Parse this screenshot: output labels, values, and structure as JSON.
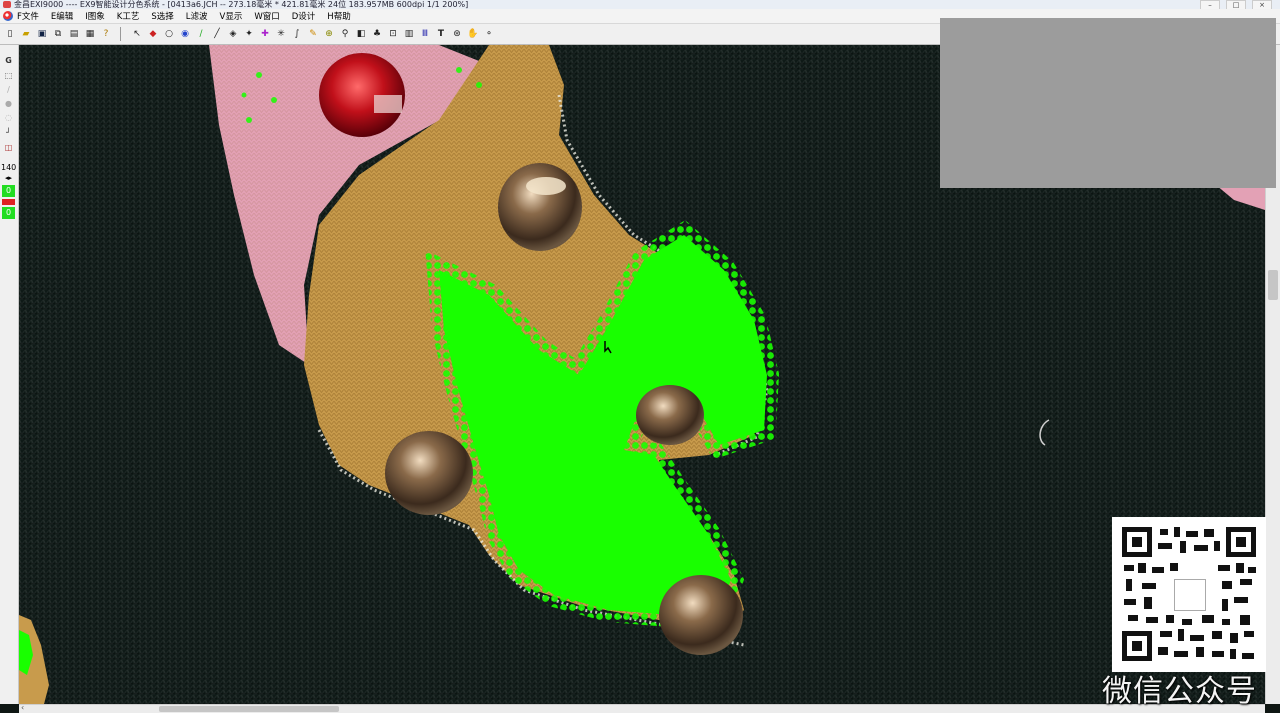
{
  "window": {
    "title": "金昌EXI9000 ---- EX9智能设计分色系统 - [0413a6.JCH -- 273.18毫米 * 421.81毫米 24位 183.957MB 600dpi 1/1 200%]"
  },
  "menubar": {
    "items": [
      "F文件",
      "E编辑",
      "I图象",
      "K工艺",
      "S选择",
      "L滤波",
      "V显示",
      "W窗口",
      "D设计",
      "H帮助"
    ]
  },
  "toolbar": {
    "icons": [
      "new-file-icon",
      "open-folder-icon",
      "save-icon",
      "copy-icon",
      "paste-icon",
      "print-icon",
      "help-icon",
      "select-arrow-icon",
      "eraser-icon",
      "ellipse-icon",
      "fill-icon",
      "pen-icon",
      "line-icon",
      "fill-bucket-icon",
      "magic-wand-icon",
      "eyedropper-icon",
      "crosshair-icon",
      "brush-icon",
      "pencil-icon",
      "stamp-icon",
      "zoom-icon",
      "frame-icon",
      "layer-icon",
      "grid-icon",
      "pattern-icon",
      "stripes-icon",
      "text-icon",
      "rotate-icon",
      "hand-icon",
      "magnifier-icon"
    ]
  },
  "leftbar": {
    "tool_g": "G",
    "brush_size": "140",
    "value_top": "0",
    "value_bottom": "0"
  },
  "watermark": {
    "text": "微信公众号"
  },
  "colors": {
    "selection_green": "#19ff00",
    "knit_dark": "#0f1a17",
    "gold_fabric": "#c79b4a",
    "pink_fabric": "#e6a0b4",
    "gem_red": "#c1101a",
    "overlay_gray": "#9c9c9c"
  }
}
